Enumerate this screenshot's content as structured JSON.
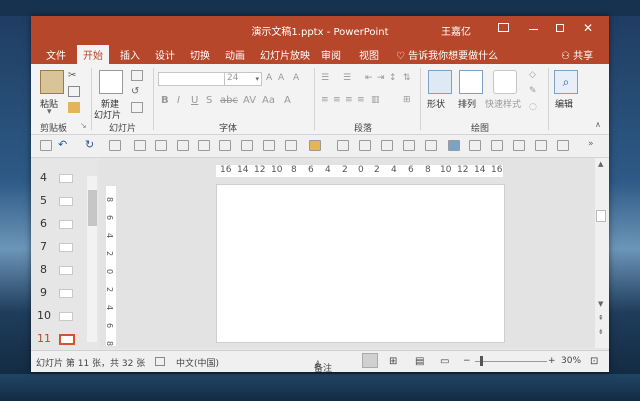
{
  "window": {
    "title": "演示文稿1.pptx - PowerPoint",
    "user": "王嘉亿",
    "accent": "#b7472a",
    "close_glyph": "✕"
  },
  "tabs": [
    "文件",
    "开始",
    "插入",
    "设计",
    "切换",
    "动画",
    "幻灯片放映",
    "审阅",
    "视图"
  ],
  "active_tab": "开始",
  "tell_me": "告诉我你想要做什么",
  "share": "共享",
  "ribbon": {
    "clipboard": {
      "paste": "粘贴",
      "label": "剪贴板"
    },
    "slides": {
      "new_line1": "新建",
      "new_line2": "幻灯片",
      "label": "幻灯片"
    },
    "font": {
      "name": "",
      "size": "24",
      "label": "字体"
    },
    "paragraph": {
      "label": "段落"
    },
    "drawing": {
      "shapes": "形状",
      "arrange": "排列",
      "quick_styles": "快速样式",
      "label": "绘图"
    },
    "editing": {
      "edit": "编辑"
    }
  },
  "thumbnails": [
    {
      "num": "4",
      "active": false
    },
    {
      "num": "5",
      "active": false
    },
    {
      "num": "6",
      "active": false
    },
    {
      "num": "7",
      "active": false
    },
    {
      "num": "8",
      "active": false
    },
    {
      "num": "9",
      "active": false
    },
    {
      "num": "10",
      "active": false
    },
    {
      "num": "11",
      "active": true
    }
  ],
  "ruler": {
    "horizontal": [
      "16",
      "14",
      "12",
      "10",
      "8",
      "6",
      "4",
      "2",
      "0",
      "2",
      "4",
      "6",
      "8",
      "10",
      "12",
      "14",
      "16"
    ],
    "vertical": [
      "8",
      "6",
      "4",
      "2",
      "0",
      "2",
      "4",
      "6",
      "8"
    ]
  },
  "status": {
    "slide_info": "幻灯片 第 11 张，共 32 张",
    "language": "中文(中国)",
    "notes": "备注",
    "zoom": "30%"
  }
}
